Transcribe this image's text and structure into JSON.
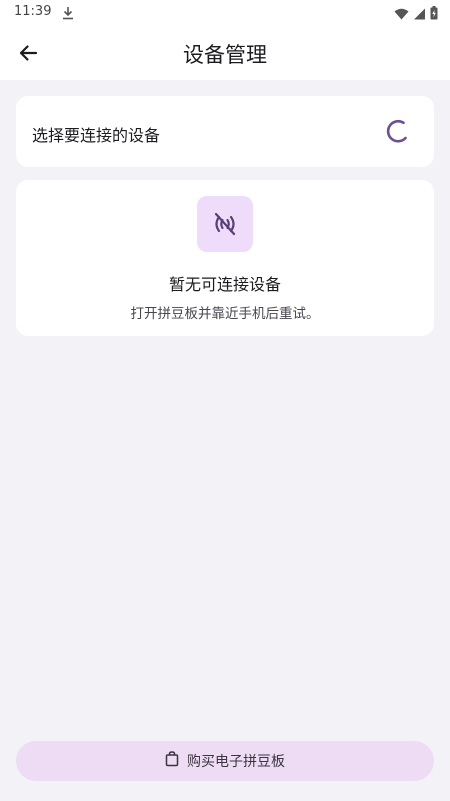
{
  "status_bar": {
    "time": "11:39",
    "icons": [
      "download-icon",
      "wifi-icon",
      "signal-icon",
      "battery-charging-icon"
    ]
  },
  "app_bar": {
    "back_icon": "arrow-left-icon",
    "title": "设备管理"
  },
  "device_select": {
    "label": "选择要连接的设备",
    "loading_icon": "loading-spinner-icon"
  },
  "empty_state": {
    "icon": "no-signal-icon",
    "title": "暂无可连接设备",
    "subtitle": "打开拼豆板并靠近手机后重试。"
  },
  "buy_button": {
    "icon": "shopping-bag-icon",
    "label": "购买电子拼豆板"
  },
  "colors": {
    "background": "#f3f2f6",
    "card": "#ffffff",
    "accent": "#6f4e8f",
    "icon_box": "#eedcfa",
    "button": "#eddcf3"
  }
}
